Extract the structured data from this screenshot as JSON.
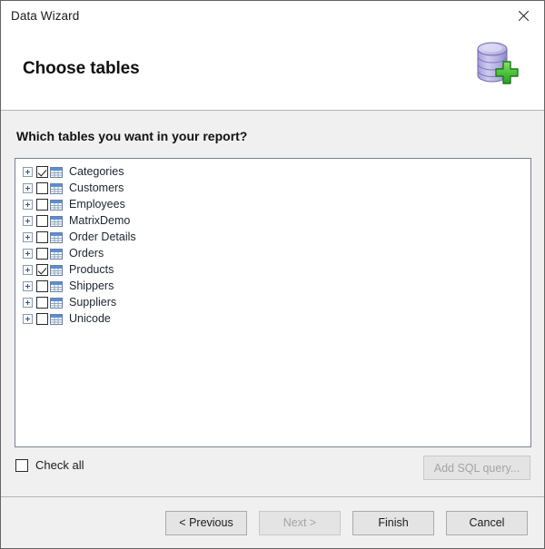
{
  "window": {
    "title": "Data Wizard",
    "close_label": "×"
  },
  "header": {
    "title": "Choose tables",
    "icon": "database-add-icon"
  },
  "main": {
    "question": "Which tables you want in your report?",
    "tree_items": [
      {
        "label": "Categories",
        "checked": true,
        "expandable": true,
        "icon": "table-icon"
      },
      {
        "label": "Customers",
        "checked": false,
        "expandable": true,
        "icon": "table-icon"
      },
      {
        "label": "Employees",
        "checked": false,
        "expandable": true,
        "icon": "table-icon"
      },
      {
        "label": "MatrixDemo",
        "checked": false,
        "expandable": true,
        "icon": "table-icon"
      },
      {
        "label": "Order Details",
        "checked": false,
        "expandable": true,
        "icon": "table-icon"
      },
      {
        "label": "Orders",
        "checked": false,
        "expandable": true,
        "icon": "table-icon"
      },
      {
        "label": "Products",
        "checked": true,
        "expandable": true,
        "icon": "table-icon"
      },
      {
        "label": "Shippers",
        "checked": false,
        "expandable": true,
        "icon": "table-icon"
      },
      {
        "label": "Suppliers",
        "checked": false,
        "expandable": true,
        "icon": "table-icon"
      },
      {
        "label": "Unicode",
        "checked": false,
        "expandable": true,
        "icon": "table-icon"
      }
    ],
    "check_all": {
      "label": "Check all",
      "checked": false
    },
    "add_sql_query": {
      "label": "Add SQL query...",
      "enabled": false
    }
  },
  "footer": {
    "buttons": [
      {
        "label": "< Previous",
        "enabled": true
      },
      {
        "label": "Next >",
        "enabled": false
      },
      {
        "label": "Finish",
        "enabled": true
      },
      {
        "label": "Cancel",
        "enabled": true
      }
    ]
  },
  "colors": {
    "window_bg": "#f0f0f0",
    "header_bg": "#ffffff",
    "border": "#646464",
    "separator": "#b4b4b4",
    "list_border": "#7a8290",
    "text": "#1b1b1b",
    "disabled_text": "#a4a4a4",
    "db_icon_body": "#b3aee0",
    "db_icon_plus": "#43c53a",
    "table_icon_header": "#5a8fd6"
  }
}
